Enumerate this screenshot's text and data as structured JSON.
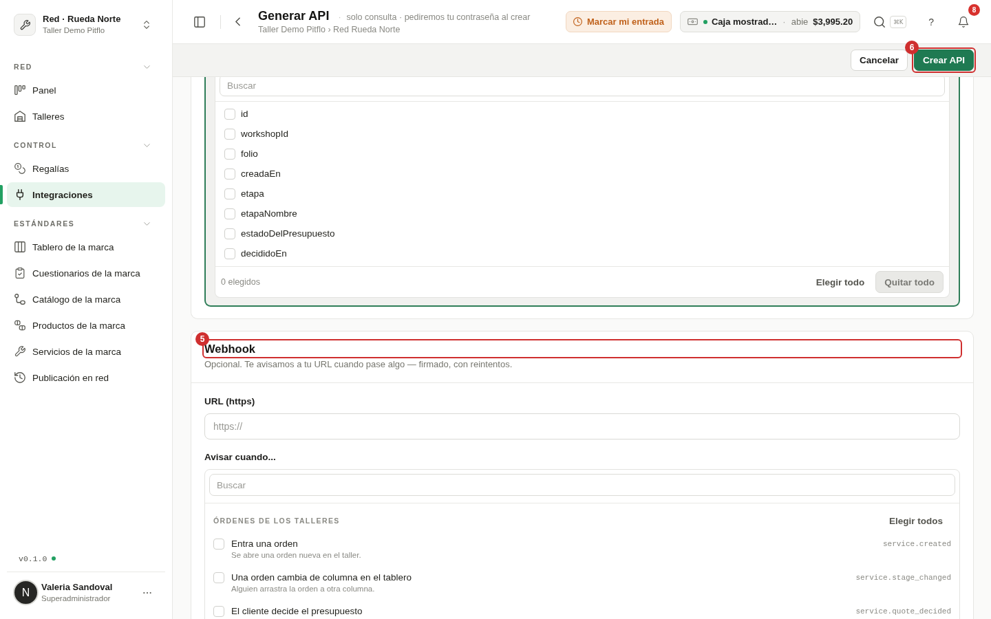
{
  "sidebar": {
    "brand": {
      "name": "Red · Rueda Norte",
      "subtitle": "Taller Demo Pitflo"
    },
    "sections": [
      {
        "title": "RED",
        "expanded": true,
        "items": [
          {
            "label": "Panel",
            "selected": false
          },
          {
            "label": "Talleres",
            "selected": false
          }
        ]
      },
      {
        "title": "CONTROL",
        "expanded": true,
        "items": [
          {
            "label": "Regalías",
            "selected": false
          },
          {
            "label": "Integraciones",
            "selected": true
          }
        ]
      },
      {
        "title": "ESTÁNDARES",
        "expanded": true,
        "items": [
          {
            "label": "Tablero de la marca",
            "selected": false
          },
          {
            "label": "Cuestionarios de la marca",
            "selected": false
          },
          {
            "label": "Catálogo de la marca",
            "selected": false
          },
          {
            "label": "Productos de la marca",
            "selected": false
          },
          {
            "label": "Servicios de la marca",
            "selected": false
          },
          {
            "label": "Publicación en red",
            "selected": false
          }
        ]
      }
    ],
    "version": {
      "label": "v0.1.0",
      "online": true
    },
    "user": {
      "initial": "N",
      "name": "Valeria Sandoval",
      "role": "Superadministrador"
    }
  },
  "header": {
    "title": "Generar API",
    "separator": "·",
    "subtitle": "solo consulta · pediremos tu contraseña al crear",
    "breadcrumb": "Taller Demo Pitflo › Red Rueda Norte",
    "clock_in": "Marcar mi entrada",
    "register": {
      "name": "Caja mostrad…",
      "open": true,
      "separator": "·",
      "status": "abie",
      "amount": "$3,995.20"
    },
    "shortcut": "⌘K",
    "help": "?",
    "notifications": "8"
  },
  "actions": [
    {
      "kind": "secondary",
      "label": "Cancelar"
    },
    {
      "kind": "primary",
      "label": "Crear API",
      "annotation": "6"
    }
  ],
  "fields": {
    "search_placeholder": "Buscar",
    "items": [
      {
        "label": "id",
        "checked": false
      },
      {
        "label": "workshopId",
        "checked": false
      },
      {
        "label": "folio",
        "checked": false
      },
      {
        "label": "creadaEn",
        "checked": false
      },
      {
        "label": "etapa",
        "checked": false
      },
      {
        "label": "etapaNombre",
        "checked": false
      },
      {
        "label": "estadoDelPresupuesto",
        "checked": false
      },
      {
        "label": "decididoEn",
        "checked": false
      }
    ],
    "count": "0 elegidos",
    "select_all": "Elegir todo",
    "clear_all": "Quitar todo"
  },
  "webhook": {
    "title": "Webhook",
    "annotation": "5",
    "description": "Opcional. Te avisamos a tu URL cuando pase algo — firmado, con reintentos.",
    "url_label": "URL (https)",
    "url_placeholder": "https://",
    "events_label": "Avisar cuando...",
    "events_search_placeholder": "Buscar",
    "groups": [
      {
        "title": "ÓRDENES DE LOS TALLERES",
        "select_all": "Elegir todos",
        "events": [
          {
            "title": "Entra una orden",
            "description": "Se abre una orden nueva en el taller.",
            "code": "service.created",
            "checked": false
          },
          {
            "title": "Una orden cambia de columna en el tablero",
            "description": "Alguien arrastra la orden a otra columna.",
            "code": "service.stage_changed",
            "checked": false
          },
          {
            "title": "El cliente decide el presupuesto",
            "code": "service.quote_decided",
            "checked": false
          }
        ]
      }
    ]
  }
}
